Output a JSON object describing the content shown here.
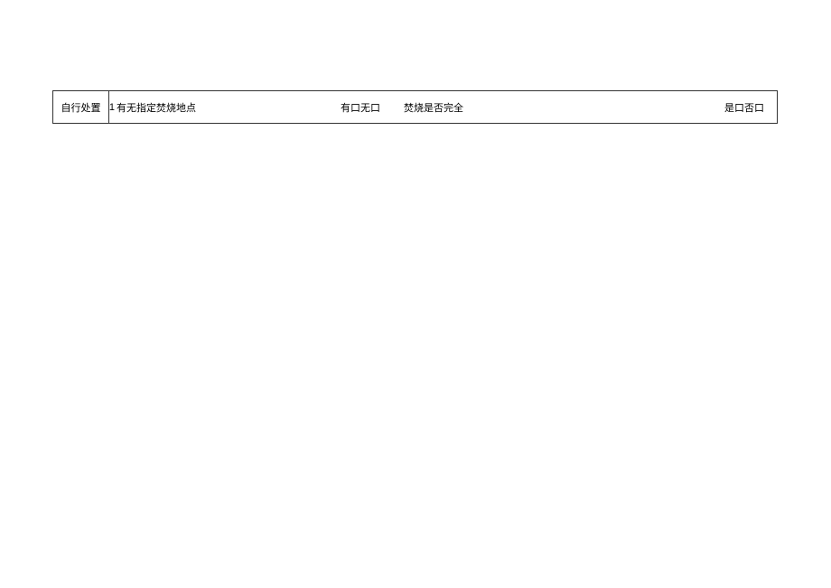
{
  "row": {
    "header": "自行处置",
    "index": "1",
    "question1": "有无指定焚烧地点",
    "opt1_yes_label": "有",
    "opt1_no_label": "无",
    "question2": "焚烧是否完全",
    "opt2_yes_label": "是",
    "opt2_no_label": "否",
    "checkbox_glyph": "口"
  }
}
